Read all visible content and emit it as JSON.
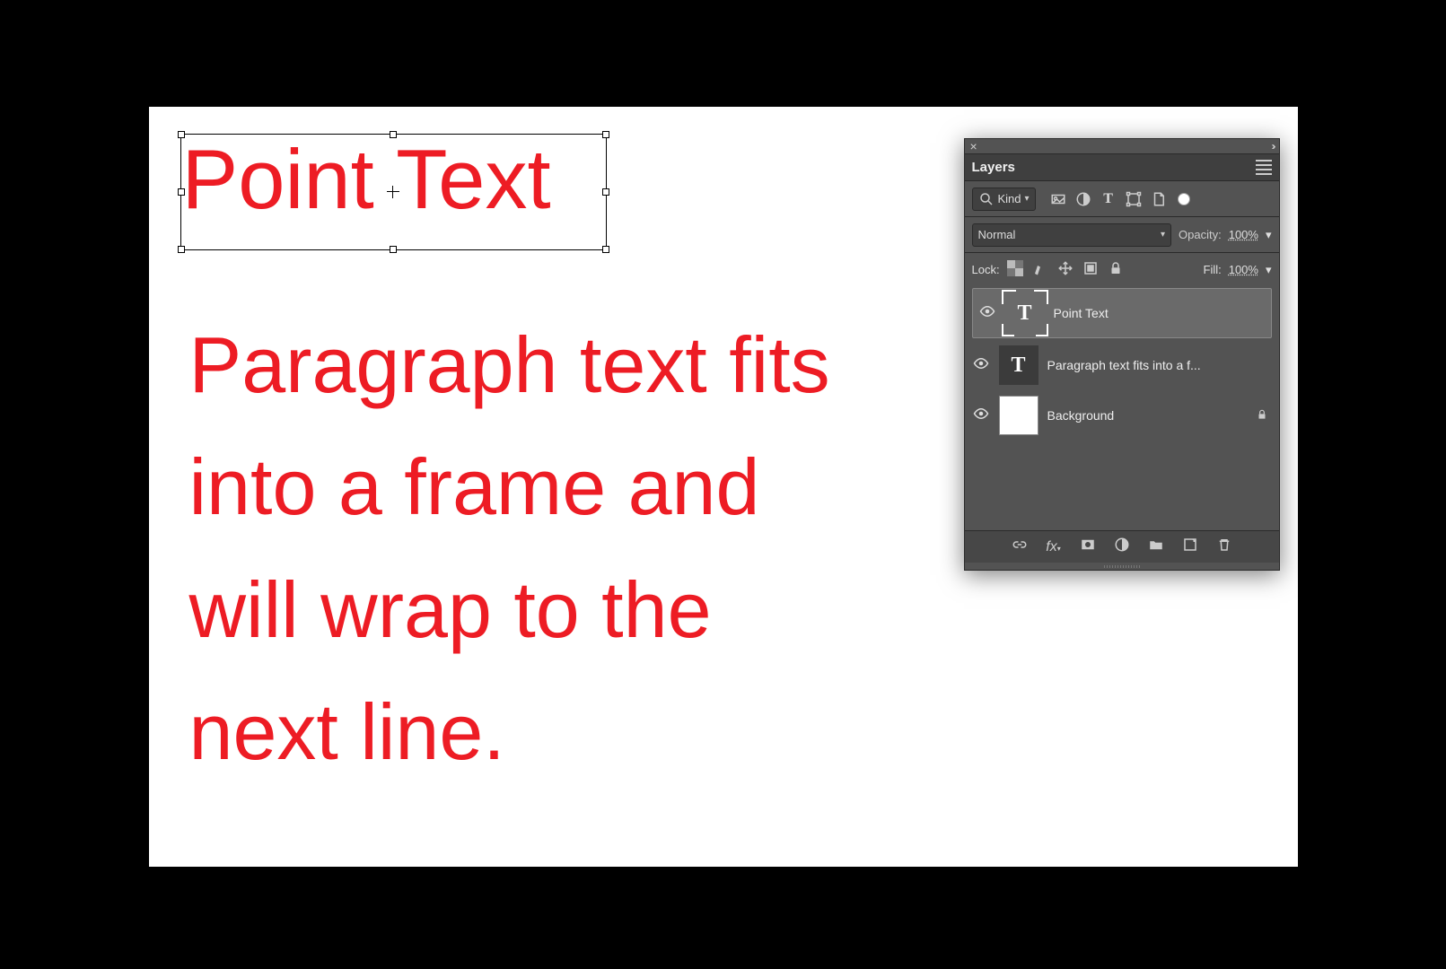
{
  "canvas": {
    "point_text": "Point Text",
    "paragraph_text": "Paragraph text fits into a frame and will wrap to the next line."
  },
  "panel": {
    "title": "Layers",
    "filter_kind_label": "Kind",
    "blend_mode": "Normal",
    "opacity_label": "Opacity:",
    "opacity_value": "100%",
    "lock_label": "Lock:",
    "fill_label": "Fill:",
    "fill_value": "100%",
    "layers": [
      {
        "name": "Point Text",
        "type": "text",
        "selected": true,
        "locked": false
      },
      {
        "name": "Paragraph text fits into a f...",
        "type": "text",
        "selected": false,
        "locked": false
      },
      {
        "name": "Background",
        "type": "raster",
        "selected": false,
        "locked": true
      }
    ]
  }
}
